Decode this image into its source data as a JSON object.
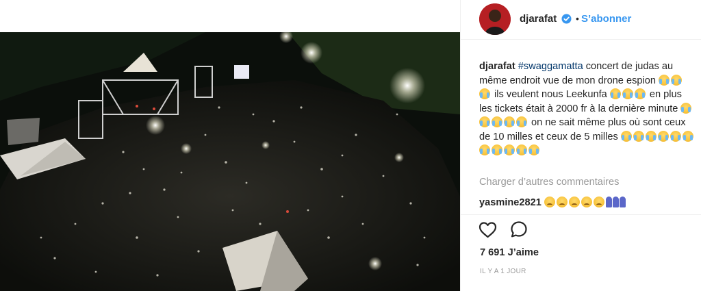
{
  "post": {
    "username": "djarafat",
    "follow_label": "S’abonner",
    "separator": "•",
    "caption": {
      "user": "djarafat",
      "hashtag": "#swaggamatta",
      "text_1": " concert de judas au même endroit vue de mon drone espion ",
      "text_2": " ils veulent nous Leekunfa ",
      "text_3": " en plus les tickets était à 2000 fr à la dernière minute ",
      "text_4": " on ne sait même plus où sont ceux de 10 milles et ceux de 5 milles "
    },
    "load_more_label": "Charger d’autres commentaires",
    "comment": {
      "user": "yasmine2821"
    },
    "likes_text": "7 691 J’aime",
    "time_text": "IL Y A 1 JOUR"
  },
  "icons": {
    "verified": "verified-badge-icon",
    "like": "heart-icon",
    "comment": "comment-bubble-icon"
  },
  "colors": {
    "link_blue": "#3897f0",
    "hashtag": "#003569",
    "muted": "#999999",
    "text": "#262626"
  }
}
